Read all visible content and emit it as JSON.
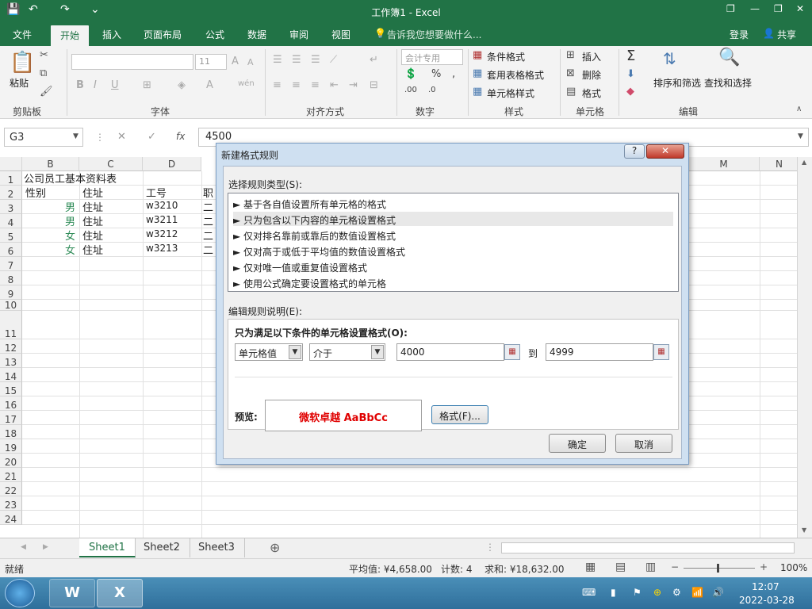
{
  "window": {
    "title": "工作簿1 - Excel",
    "help_icon": "?",
    "restore_icon": "❐",
    "minimize_icon": "—",
    "maximize_icon": "❐",
    "close_icon": "✕"
  },
  "quick_access": {
    "save_icon": "💾",
    "undo_icon": "↶",
    "redo_icon": "↷",
    "customize_icon": "⌄"
  },
  "tabs": [
    "文件",
    "开始",
    "插入",
    "页面布局",
    "公式",
    "数据",
    "审阅",
    "视图"
  ],
  "active_tab": "开始",
  "tell_me": "告诉我您想要做什么...",
  "account": {
    "login": "登录",
    "share": "共享"
  },
  "ribbon": {
    "clipboard": {
      "label": "剪贴板",
      "paste": "粘贴"
    },
    "font": {
      "label": "字体",
      "font_size": "11",
      "bold": "B",
      "italic": "I",
      "underline": "U",
      "font_color": "A",
      "wen": "wén"
    },
    "alignment": {
      "label": "对齐方式"
    },
    "number": {
      "label": "数字",
      "format": "会计专用",
      "percent": "%"
    },
    "styles": {
      "label": "样式",
      "conditional": "条件格式",
      "table": "套用表格格式",
      "cell_styles": "单元格样式"
    },
    "cells": {
      "label": "单元格",
      "insert": "插入",
      "delete": "删除",
      "format": "格式"
    },
    "editing": {
      "label": "编辑",
      "sort": "排序和筛选",
      "find": "查找和选择"
    }
  },
  "formula_bar": {
    "name_box": "G3",
    "fx": "fx",
    "value": "4500"
  },
  "columns": [
    "B",
    "C",
    "D",
    "M",
    "N"
  ],
  "rows": [
    "1",
    "2",
    "3",
    "4",
    "5",
    "6",
    "7",
    "8",
    "9",
    "10",
    "11",
    "12",
    "13",
    "14",
    "15",
    "16",
    "17",
    "18",
    "19",
    "20",
    "21",
    "22",
    "23",
    "24"
  ],
  "cells": {
    "b1": "公司员工基本资料表",
    "headers": [
      "性别",
      "住址",
      "工号",
      "职"
    ],
    "data": [
      {
        "gender": "男",
        "addr": "住址",
        "id": "w3210",
        "d": "二"
      },
      {
        "gender": "男",
        "addr": "住址",
        "id": "w3211",
        "d": "二"
      },
      {
        "gender": "女",
        "addr": "住址",
        "id": "w3212",
        "d": "二"
      },
      {
        "gender": "女",
        "addr": "住址",
        "id": "w3213",
        "d": "二"
      }
    ]
  },
  "sheets": [
    "Sheet1",
    "Sheet2",
    "Sheet3"
  ],
  "active_sheet": "Sheet1",
  "status": {
    "mode": "就绪",
    "average": "平均值: ¥4,658.00",
    "count": "计数: 4",
    "sum": "求和: ¥18,632.00",
    "zoom": "100%"
  },
  "dialog": {
    "title": "新建格式规则",
    "select_type_label": "选择规则类型(S):",
    "rules": [
      "► 基于各自值设置所有单元格的格式",
      "► 只为包含以下内容的单元格设置格式",
      "► 仅对排名靠前或靠后的数值设置格式",
      "► 仅对高于或低于平均值的数值设置格式",
      "► 仅对唯一值或重复值设置格式",
      "► 使用公式确定要设置格式的单元格"
    ],
    "selected_rule_index": 1,
    "edit_label": "编辑规则说明(E):",
    "condition_heading": "只为满足以下条件的单元格设置格式(O):",
    "field1": "单元格值",
    "operator": "介于",
    "value1": "4000",
    "to": "到",
    "value2": "4999",
    "preview_label": "预览:",
    "preview_text": "微软卓越  AaBbCc",
    "format_button": "格式(F)...",
    "ok": "确定",
    "cancel": "取消"
  },
  "taskbar": {
    "time": "12:07",
    "date": "2022-03-28"
  }
}
